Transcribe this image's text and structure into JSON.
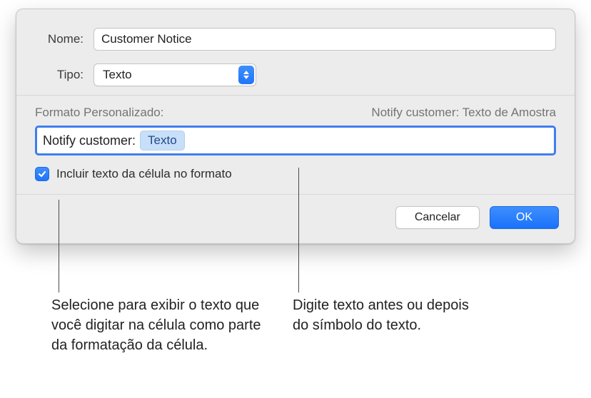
{
  "fields": {
    "name_label": "Nome:",
    "name_value": "Customer Notice",
    "type_label": "Tipo:",
    "type_value": "Texto"
  },
  "format": {
    "label": "Formato Personalizado:",
    "preview": "Notify customer: Texto de Amostra",
    "prefix_text": "Notify customer:",
    "token_label": "Texto"
  },
  "checkbox": {
    "checked": true,
    "label": "Incluir texto da célula no formato"
  },
  "buttons": {
    "cancel": "Cancelar",
    "ok": "OK"
  },
  "callouts": {
    "left": "Selecione para exibir o texto que você digitar na célula como parte da formatação da célula.",
    "right": "Digite texto antes ou depois do símbolo do texto."
  }
}
